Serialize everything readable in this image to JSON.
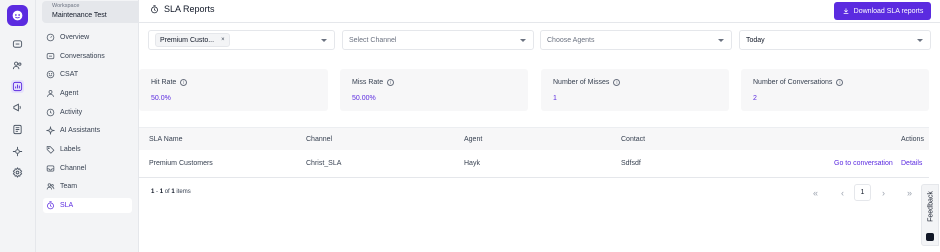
{
  "workspace": {
    "caption": "Workspace",
    "name": "Maintenance Test"
  },
  "nav": [
    {
      "label": "Overview",
      "icon": "overview-icon",
      "active": false
    },
    {
      "label": "Conversations",
      "icon": "conversations-icon",
      "active": false
    },
    {
      "label": "CSAT",
      "icon": "csat-icon",
      "active": false
    },
    {
      "label": "Agent",
      "icon": "agent-icon",
      "active": false
    },
    {
      "label": "Activity",
      "icon": "activity-icon",
      "active": false
    },
    {
      "label": "AI Assistants",
      "icon": "ai-assistants-icon",
      "active": false
    },
    {
      "label": "Labels",
      "icon": "labels-icon",
      "active": false
    },
    {
      "label": "Channel",
      "icon": "channel-icon",
      "active": false
    },
    {
      "label": "Team",
      "icon": "team-icon",
      "active": false
    },
    {
      "label": "SLA",
      "icon": "sla-icon",
      "active": true
    }
  ],
  "rail_icons": [
    "chat-icon",
    "contacts-icon",
    "reports-icon",
    "campaigns-icon",
    "help-center-icon",
    "integrations-icon",
    "settings-icon"
  ],
  "header": {
    "title": "SLA Reports",
    "download_label": "Download SLA reports"
  },
  "filters": {
    "sla_chip": "Premium Custo...",
    "chip_remove": "×",
    "channel_placeholder": "Select Channel",
    "agents_placeholder": "Choose Agents",
    "date_value": "Today"
  },
  "stats": {
    "hit_rate": {
      "label": "Hit Rate",
      "value": "50.0%"
    },
    "miss_rate": {
      "label": "Miss Rate",
      "value": "50.00%"
    },
    "misses": {
      "label": "Number of Misses",
      "value": "1"
    },
    "conversations": {
      "label": "Number of Conversations",
      "value": "2"
    }
  },
  "table": {
    "columns": {
      "sla_name": "SLA Name",
      "channel": "Channel",
      "agent": "Agent",
      "contact": "Contact",
      "actions": "Actions"
    },
    "rows": [
      {
        "sla_name": "Premium Customers",
        "channel": "Christ_SLA",
        "agent": "Hayk",
        "contact": "Sdfsdf",
        "action_go": "Go to conversation",
        "action_details": "Details"
      }
    ]
  },
  "pagination": {
    "range_start": "1",
    "range_sep": " - ",
    "range_end": "1",
    "of_text": " of ",
    "total": "1",
    "items_text": " items",
    "first": "«",
    "prev": "‹",
    "page": "1",
    "next": "›",
    "last": "»"
  },
  "feedback": {
    "label": "Feedback"
  },
  "colors": {
    "accent": "#5b2be0",
    "sidebar_bg": "#f3f4f6",
    "card_bg": "#f7f7f8"
  }
}
